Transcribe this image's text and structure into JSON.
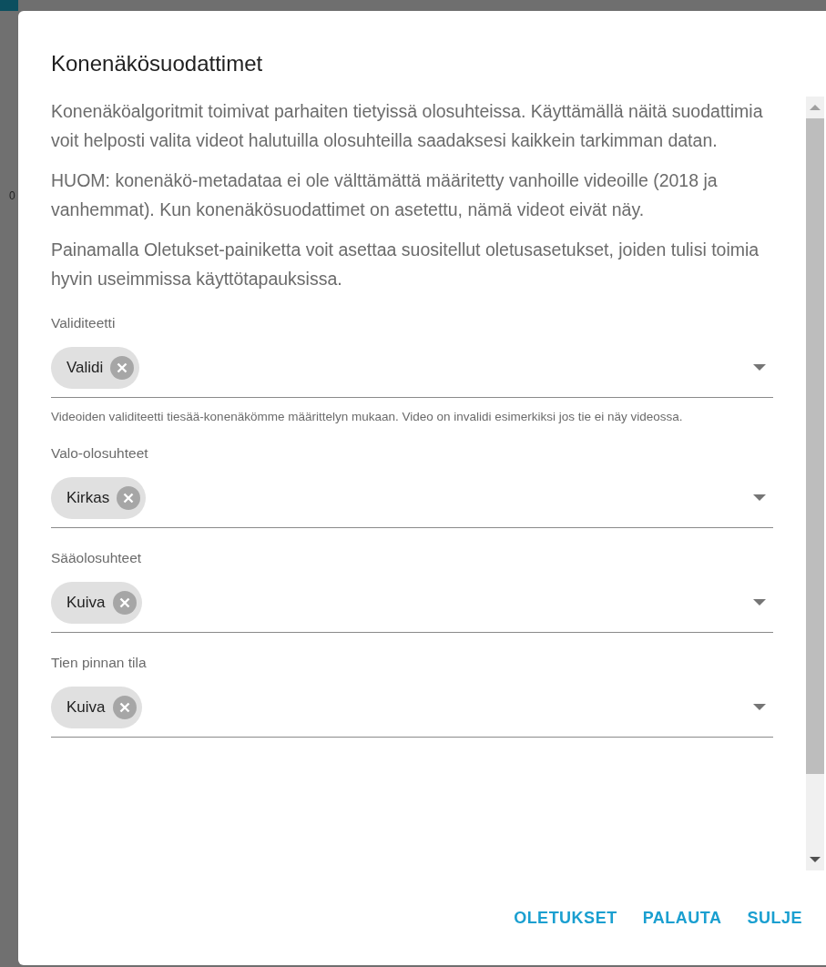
{
  "background": {
    "label": "0"
  },
  "dialog": {
    "title": "Konenäkösuodattimet",
    "paragraphs": [
      "Konenäköalgoritmit toimivat parhaiten tietyissä olosuhteissa. Käyttämällä näitä suodattimia voit helposti valita videot halutuilla olosuhteilla saadaksesi kaikkein tarkimman datan.",
      "HUOM: konenäkö-metadataa ei ole välttämättä määritetty vanhoille videoille (2018 ja vanhemmat). Kun konenäkösuodattimet on asetettu, nämä videot eivät näy.",
      "Painamalla Oletukset-painiketta voit asettaa suositellut oletusasetukset, joiden tulisi toimia hyvin useimmissa käyttötapauksissa."
    ],
    "fields": [
      {
        "label": "Validiteetti",
        "chips": [
          "Validi"
        ],
        "hint": "Videoiden validiteetti tiesää-konenäkömme määrittelyn mukaan. Video on invalidi esimerkiksi jos tie ei näy videossa."
      },
      {
        "label": "Valo-olosuhteet",
        "chips": [
          "Kirkas"
        ]
      },
      {
        "label": "Sääolosuhteet",
        "chips": [
          "Kuiva"
        ]
      },
      {
        "label": "Tien pinnan tila",
        "chips": [
          "Kuiva"
        ]
      }
    ],
    "buttons": [
      "OLETUKSET",
      "PALAUTA",
      "SULJE"
    ]
  }
}
